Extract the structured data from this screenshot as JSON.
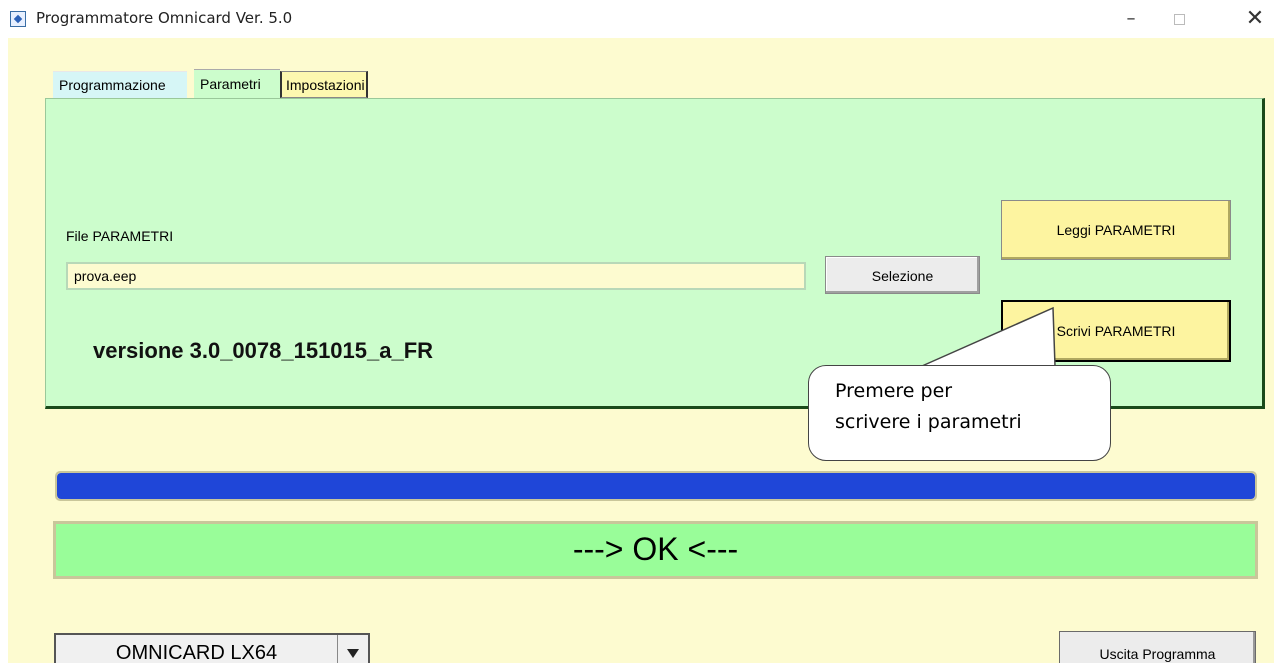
{
  "window": {
    "title": "Programmatore Omnicard Ver. 5.0",
    "minimize": "–",
    "close": "✕"
  },
  "tabs": [
    {
      "label": "Programmazione"
    },
    {
      "label": "Parametri",
      "selected": true
    },
    {
      "label": "Impostazioni"
    }
  ],
  "panel": {
    "file_label": "File PARAMETRI",
    "file_value": "prova.eep",
    "select_button": "Selezione",
    "read_button": "Leggi PARAMETRI",
    "write_button": "Scrivi PARAMETRI",
    "version": "versione 3.0_0078_151015_a_FR"
  },
  "progress": {
    "value": 1.0,
    "color": "#1f46d8"
  },
  "status": {
    "text": "---> OK <---",
    "color": "#99fd99"
  },
  "callout": {
    "line1": "Premere per",
    "line2": "scrivere i parametri"
  },
  "footer": {
    "device_selected": "OMNICARD LX64",
    "exit_button": "Uscita Programma"
  },
  "colors": {
    "background": "#fdfbd0",
    "panel": "#ccfdcc",
    "button_yellow": "#fdf4a0"
  }
}
